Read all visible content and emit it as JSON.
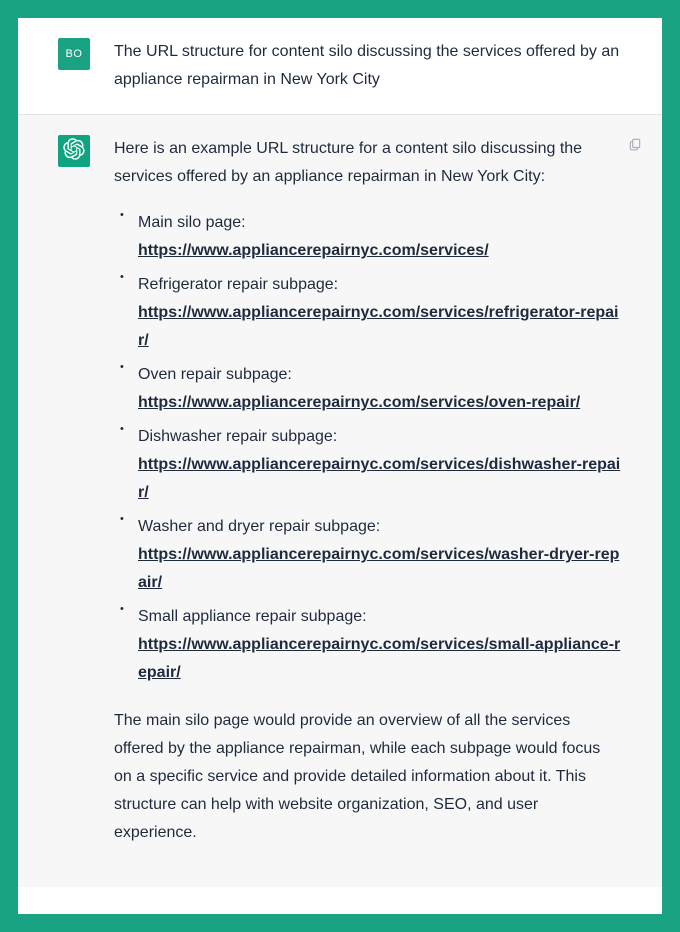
{
  "user": {
    "avatar_initials": "BO",
    "prompt": "The URL structure for content silo discussing the services offered by an appliance repairman in New York City"
  },
  "assistant": {
    "intro": "Here is an example URL structure for a content silo discussing the services offered by an appliance repairman in New York City:",
    "items": [
      {
        "label": "Main silo page:",
        "url": "https://www.appliancerepairnyc.com/services/"
      },
      {
        "label": "Refrigerator repair subpage:",
        "url": "https://www.appliancerepairnyc.com/services/refrigerator-repair/"
      },
      {
        "label": "Oven repair subpage:",
        "url": "https://www.appliancerepairnyc.com/services/oven-repair/"
      },
      {
        "label": "Dishwasher repair subpage:",
        "url": "https://www.appliancerepairnyc.com/services/dishwasher-repair/"
      },
      {
        "label": "Washer and dryer repair subpage:",
        "url": "https://www.appliancerepairnyc.com/services/washer-dryer-repair/"
      },
      {
        "label": "Small appliance repair subpage:",
        "url": "https://www.appliancerepairnyc.com/services/small-appliance-repair/"
      }
    ],
    "outro": "The main silo page would provide an overview of all the services offered by the appliance repairman, while each subpage would focus on a specific service and provide detailed information about it. This structure can help with website organization, SEO, and user experience."
  }
}
